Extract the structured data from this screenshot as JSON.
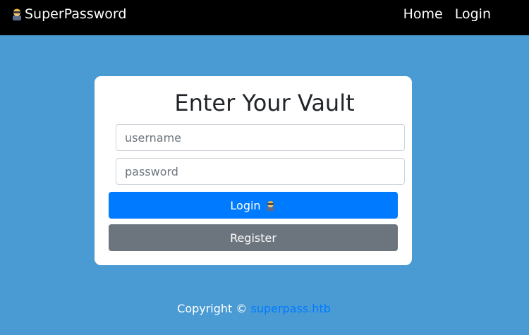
{
  "navbar": {
    "brand_label": "SuperPassword",
    "brand_icon": "agent-emoji-icon",
    "links": [
      {
        "label": "Home"
      },
      {
        "label": "Login"
      }
    ]
  },
  "login_card": {
    "title": "Enter Your Vault",
    "username_placeholder": "username",
    "password_placeholder": "password",
    "login_button_label": "Login",
    "login_button_icon": "agent-emoji-icon",
    "register_button_label": "Register"
  },
  "footer": {
    "copyright_prefix": "Copyright ©",
    "link_text": "superpass.htb"
  },
  "colors": {
    "page_background": "#4a9bd4",
    "navbar_background": "#000000",
    "primary_button": "#007bff",
    "secondary_button": "#6c757d",
    "link": "#007bff"
  }
}
